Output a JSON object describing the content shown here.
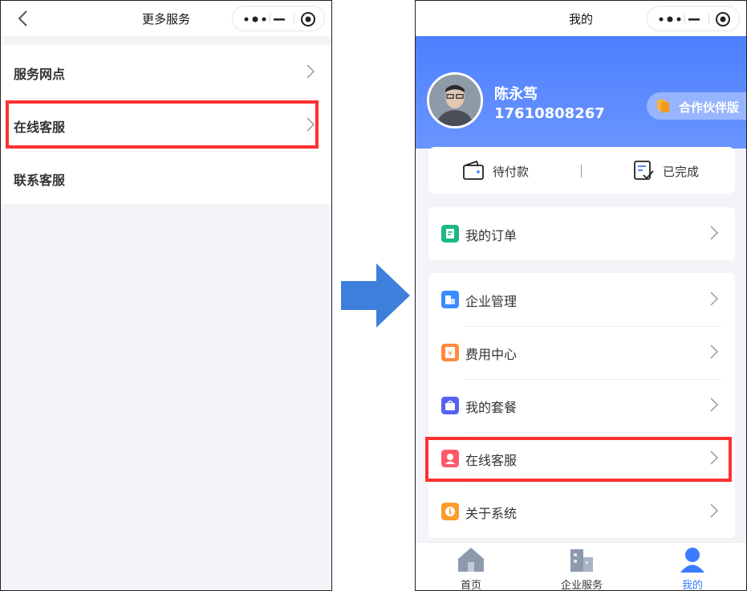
{
  "left_screen": {
    "title": "更多服务",
    "items": [
      {
        "label": "服务网点"
      },
      {
        "label": "在线客服"
      },
      {
        "label": "联系客服"
      }
    ]
  },
  "right_screen": {
    "title": "我的",
    "user": {
      "name": "陈永笃",
      "phone": "17610808267",
      "badge": "合作伙伴版"
    },
    "status": [
      {
        "label": "待付款",
        "icon": "wallet-icon"
      },
      {
        "label": "已完成",
        "icon": "completed-icon"
      }
    ],
    "orders": {
      "label": "我的订单",
      "icon": "order-icon",
      "color": "#1db77f"
    },
    "menu": [
      {
        "label": "企业管理",
        "icon": "enterprise-icon",
        "color": "#3a8bff"
      },
      {
        "label": "费用中心",
        "icon": "fee-icon",
        "color": "#ff8a3d"
      },
      {
        "label": "我的套餐",
        "icon": "package-icon",
        "color": "#5562f0"
      },
      {
        "label": "在线客服",
        "icon": "service-icon",
        "color": "#ff5a6a"
      },
      {
        "label": "关于系统",
        "icon": "info-icon",
        "color": "#ff9a2e"
      }
    ],
    "tabs": [
      {
        "label": "首页",
        "icon": "home-icon"
      },
      {
        "label": "企业服务",
        "icon": "building-icon"
      },
      {
        "label": "我的",
        "icon": "person-icon"
      }
    ]
  },
  "colors": {
    "highlight": "#ff3131",
    "primary_blue": "#4d80ff",
    "arrow_blue": "#3d7fdb",
    "tab_active": "#3a7bff"
  }
}
